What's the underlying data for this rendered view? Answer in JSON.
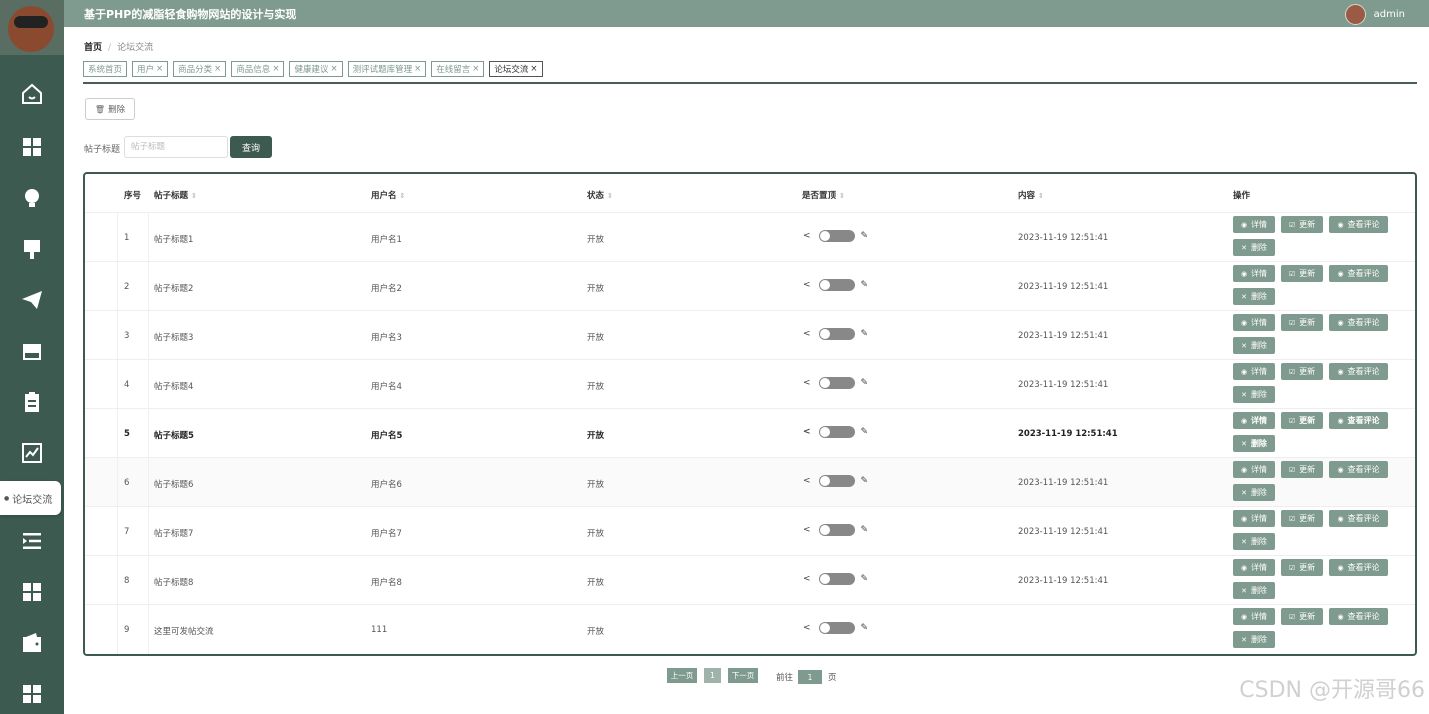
{
  "header": {
    "title": "基于PHP的减脂轻食购物网站的设计与实现",
    "username": "admin"
  },
  "sidebar": {
    "tooltip": "论坛交流",
    "icons": [
      "home-icon",
      "grid-icon",
      "lightbulb-icon",
      "brush-icon",
      "paper-plane-icon",
      "store-icon",
      "clipboard-icon",
      "chart-icon",
      "list-indent-icon",
      "grid-icon-2",
      "wallet-icon",
      "grid-icon-3"
    ]
  },
  "breadcrumb": {
    "home": "首页",
    "sep": "/",
    "current": "论坛交流"
  },
  "tabs": [
    {
      "label": "系统首页",
      "closable": false
    },
    {
      "label": "用户",
      "closable": true
    },
    {
      "label": "商品分类",
      "closable": true
    },
    {
      "label": "商品信息",
      "closable": true
    },
    {
      "label": "健康建议",
      "closable": true
    },
    {
      "label": "测评试题库管理",
      "closable": true
    },
    {
      "label": "在线留言",
      "closable": true
    },
    {
      "label": "论坛交流",
      "closable": true,
      "active": true
    }
  ],
  "toolbar": {
    "delete_label": "删除"
  },
  "search": {
    "label": "帖子标题",
    "placeholder": "帖子标题",
    "button": "查询"
  },
  "table": {
    "headers": {
      "index": "序号",
      "title": "帖子标题",
      "user": "用户名",
      "status": "状态",
      "pinned": "是否置顶",
      "content": "内容",
      "ops": "操作"
    },
    "rows": [
      {
        "index": "1",
        "title": "帖子标题1",
        "user": "用户名1",
        "status": "开放",
        "content": "2023-11-19 12:51:41"
      },
      {
        "index": "2",
        "title": "帖子标题2",
        "user": "用户名2",
        "status": "开放",
        "content": "2023-11-19 12:51:41"
      },
      {
        "index": "3",
        "title": "帖子标题3",
        "user": "用户名3",
        "status": "开放",
        "content": "2023-11-19 12:51:41"
      },
      {
        "index": "4",
        "title": "帖子标题4",
        "user": "用户名4",
        "status": "开放",
        "content": "2023-11-19 12:51:41"
      },
      {
        "index": "5",
        "title": "帖子标题5",
        "user": "用户名5",
        "status": "开放",
        "content": "2023-11-19 12:51:41"
      },
      {
        "index": "6",
        "title": "帖子标题6",
        "user": "用户名6",
        "status": "开放",
        "content": "2023-11-19 12:51:41"
      },
      {
        "index": "7",
        "title": "帖子标题7",
        "user": "用户名7",
        "status": "开放",
        "content": "2023-11-19 12:51:41"
      },
      {
        "index": "8",
        "title": "帖子标题8",
        "user": "用户名8",
        "status": "开放",
        "content": "2023-11-19 12:51:41"
      },
      {
        "index": "9",
        "title": "这里可发帖交流",
        "user": "111",
        "status": "开放",
        "content": ""
      }
    ],
    "op_labels": {
      "detail": "详情",
      "update": "更新",
      "comments": "查看评论",
      "delete": "删除"
    }
  },
  "pagination": {
    "prev": "上一页",
    "page": "1",
    "next": "下一页",
    "goto_prefix": "前往",
    "goto_value": "1",
    "goto_suffix": "页"
  },
  "watermark": "CSDN @开源哥66",
  "colors": {
    "primary": "#3d5a50",
    "accent": "#7f9a8e"
  }
}
